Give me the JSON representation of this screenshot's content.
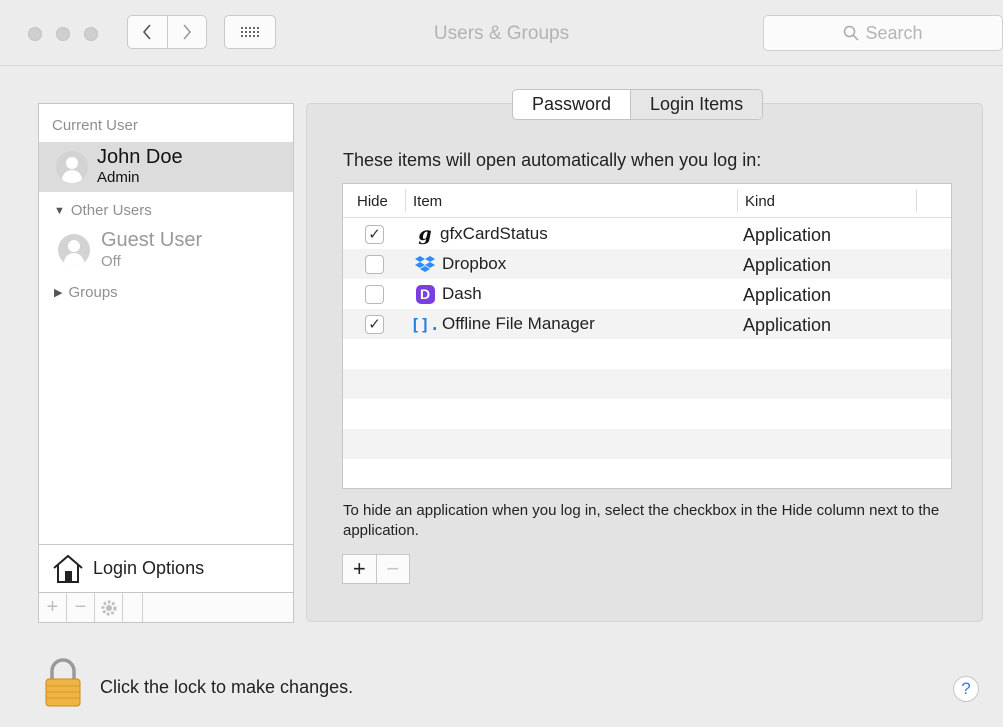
{
  "window": {
    "title": "Users & Groups"
  },
  "search": {
    "placeholder": "Search"
  },
  "sidebar": {
    "current_user_heading": "Current User",
    "current_user": {
      "name": "John Doe",
      "role": "Admin"
    },
    "other_users_heading": "Other Users",
    "guest": {
      "name": "Guest User",
      "status": "Off"
    },
    "groups_label": "Groups",
    "login_options_label": "Login Options"
  },
  "tabs": [
    {
      "label": "Password"
    },
    {
      "label": "Login Items"
    }
  ],
  "main": {
    "intro": "These items will open automatically when you log in:",
    "columns": {
      "hide": "Hide",
      "item": "Item",
      "kind": "Kind"
    },
    "rows": [
      {
        "hide": true,
        "name": "gfxCardStatus",
        "kind": "Application",
        "icon": "gfxcardstatus-icon"
      },
      {
        "hide": false,
        "name": "Dropbox",
        "kind": "Application",
        "icon": "dropbox-icon"
      },
      {
        "hide": false,
        "name": "Dash",
        "kind": "Application",
        "icon": "dash-icon"
      },
      {
        "hide": true,
        "name": "Offline File Manager",
        "kind": "Application",
        "icon": "offline-file-manager-icon"
      }
    ],
    "hint": "To hide an application when you log in, select the checkbox in the Hide column next to the application."
  },
  "footer": {
    "lock_text": "Click the lock to make changes.",
    "help_label": "?"
  },
  "colors": {
    "accent": "#3478f6",
    "dropbox": "#2f8cff",
    "dash": "#7b3fe0"
  }
}
